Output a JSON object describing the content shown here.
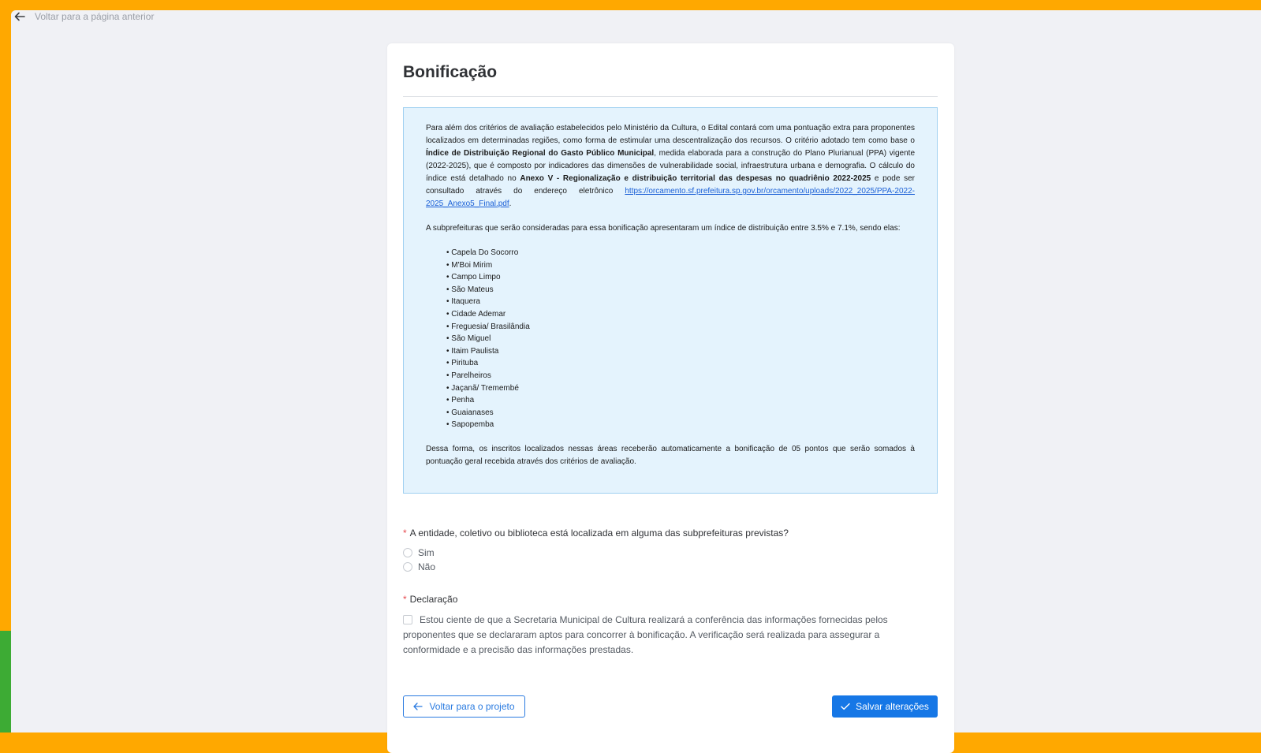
{
  "colors": {
    "frame_orange": "#ffa800",
    "frame_green": "#3dab34",
    "primary_blue": "#1677e6",
    "info_bg": "#e4f3fd",
    "required_red": "#e5484d"
  },
  "nav": {
    "back_icon": "arrow-left-icon",
    "back_label": "Voltar para a página anterior"
  },
  "card": {
    "title": "Bonificação"
  },
  "info": {
    "p1_a": "Para além dos critérios de avaliação estabelecidos pelo Ministério da Cultura, o Edital contará com uma pontuação extra para proponentes localizados em determinadas regiões, como forma de estimular uma descentralização dos recursos. O critério adotado tem como base o ",
    "p1_b": "Índice de Distribuição Regional do Gasto Público Municipal",
    "p1_c": ", medida elaborada para a construção do Plano Plurianual (PPA) vigente (2022-2025), que é composto por indicadores das dimensões de vulnerabilidade social, infraestrutura urbana e demografia. O cálculo do índice está detalhado no ",
    "p1_d": "Anexo V - Regionalização e distribuição territorial das despesas no quadriênio 2022-2025",
    "p1_e": " e pode ser consultado através do endereço eletrônico ",
    "link": "https://orcamento.sf.prefeitura.sp.gov.br/orcamento/uploads/2022_2025/PPA-2022-2025_Anexo5_Final.pdf",
    "p1_f": ".",
    "p2": "A subprefeituras que serão consideradas para essa bonificação apresentaram um índice de distribuição entre 3.5% e 7.1%, sendo elas:",
    "subprefeituras": [
      "Capela Do Socorro",
      "M'Boi Mirim",
      "Campo Limpo",
      "São Mateus",
      "Itaquera",
      "Cidade Ademar",
      "Freguesia/ Brasilândia",
      "São Miguel",
      "Itaim Paulista",
      "Pirituba",
      "Parelheiros",
      "Jaçanã/ Tremembé",
      "Penha",
      "Guaianases",
      "Sapopemba"
    ],
    "p3": "Dessa forma, os inscritos localizados nessas áreas receberão automaticamente a bonificação de 05 pontos que serão somados à pontuação geral recebida através dos critérios de avaliação."
  },
  "form": {
    "required_mark": "*",
    "question": "A entidade, coletivo ou biblioteca está localizada em alguma das subprefeituras previstas?",
    "options": [
      "Sim",
      "Não"
    ],
    "declaration_title": "Declaração",
    "declaration_text": "Estou ciente de que a Secretaria Municipal de Cultura realizará a conferência das informações fornecidas pelos proponentes que se declararam aptos para concorrer à bonificação. A verificação será realizada para assegurar a conformidade e a precisão das informações prestadas."
  },
  "buttons": {
    "back_project": "Voltar para o projeto",
    "back_project_icon": "arrow-left-icon",
    "save": "Salvar alterações",
    "save_icon": "check-icon"
  }
}
